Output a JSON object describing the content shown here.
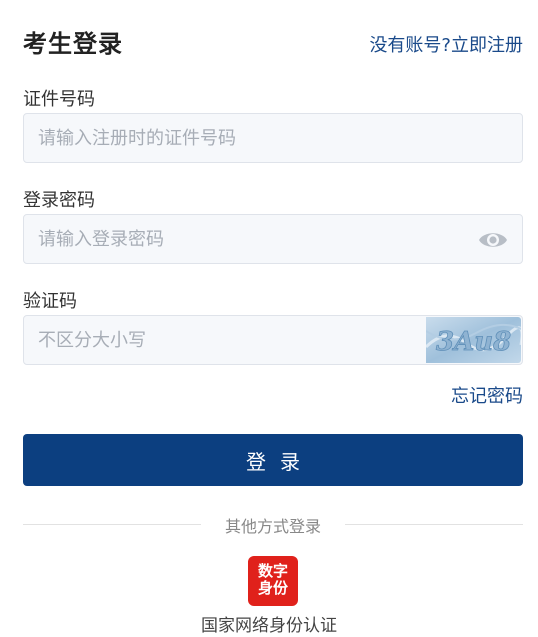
{
  "header": {
    "title": "考生登录",
    "register_link": "没有账号?立即注册"
  },
  "form": {
    "id_label": "证件号码",
    "id_placeholder": "请输入注册时的证件号码",
    "password_label": "登录密码",
    "password_placeholder": "请输入登录密码",
    "captcha_label": "验证码",
    "captcha_placeholder": "不区分大小写",
    "captcha_text": "3Au8",
    "forgot_link": "忘记密码",
    "login_button": "登录"
  },
  "other_login": {
    "divider_text": "其他方式登录",
    "badge_line1": "数字",
    "badge_line2": "身份",
    "label": "国家网络身份认证"
  },
  "colors": {
    "primary": "#0c3f80",
    "link": "#1a4a8a",
    "badge": "#e0211b"
  }
}
